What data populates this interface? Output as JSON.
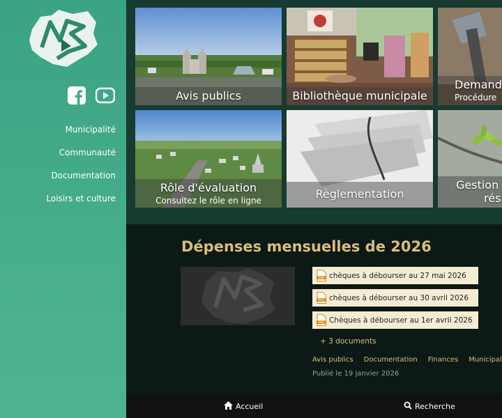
{
  "sidebar": {
    "menu": [
      {
        "label": "Municipalité"
      },
      {
        "label": "Communauté"
      },
      {
        "label": "Documentation"
      },
      {
        "label": "Loisirs et culture"
      }
    ]
  },
  "tiles": [
    {
      "title": "Avis publics",
      "subtitle": ""
    },
    {
      "title": "Bibliothèque municipale",
      "subtitle": ""
    },
    {
      "title": "Demande",
      "subtitle": "Procédure"
    },
    {
      "title": "Rôle d'évaluation",
      "subtitle": "Consultez le rôle en ligne"
    },
    {
      "title": "Règlementation",
      "subtitle": ""
    },
    {
      "title": "Gestion d",
      "subtitle": "rési"
    }
  ],
  "section": {
    "title": "Dépenses mensuelles de 2026",
    "documents": [
      {
        "label": "chèques à débourser au 27 mai 2026",
        "icon": "pdf-icon"
      },
      {
        "label": "chèques à débourser au 30 avril 2026",
        "icon": "pdf-icon"
      },
      {
        "label": "Chèques à débourser au 1er avril 2026",
        "icon": "pdf-icon"
      }
    ],
    "more_label": "+ 3 documents",
    "tags": [
      "Avis publics",
      "Documentation",
      "Finances",
      "Municipalité"
    ],
    "published": "Publié le 19 janvier 2026"
  },
  "bottom_nav": {
    "home_label": "Accueil",
    "search_label": "Recherche"
  },
  "colors": {
    "sidebar": "#45ac8b",
    "accent_gold": "#d8bf78",
    "tiles_bg": "#173a31"
  }
}
